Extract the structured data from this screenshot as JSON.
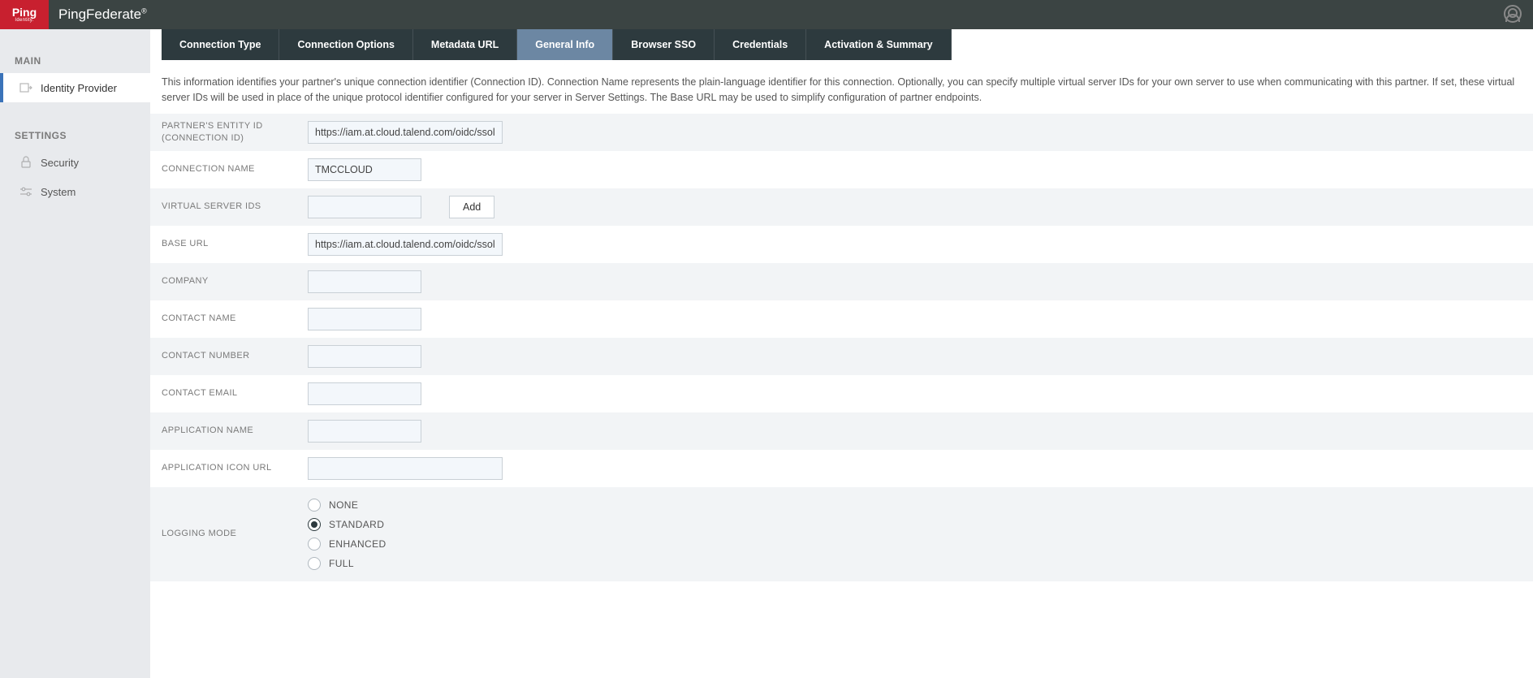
{
  "brand": {
    "logo_main": "Ping",
    "logo_sub": "Identity.",
    "name_a": "Ping",
    "name_b": "Federate"
  },
  "sidebar": {
    "section_main": "MAIN",
    "section_settings": "SETTINGS",
    "items": {
      "idp": "Identity Provider",
      "security": "Security",
      "system": "System"
    }
  },
  "tabs": [
    "Connection Type",
    "Connection Options",
    "Metadata URL",
    "General Info",
    "Browser SSO",
    "Credentials",
    "Activation & Summary"
  ],
  "active_tab_index": 3,
  "description": "This information identifies your partner's unique connection identifier (Connection ID). Connection Name represents the plain-language identifier for this connection. Optionally, you can specify multiple virtual server IDs for your own server to use when communicating with this partner. If set, these virtual server IDs will be used in place of the unique protocol identifier configured for your server in Server Settings. The Base URL may be used to simplify configuration of partner endpoints.",
  "form": {
    "entity_id_label": "PARTNER'S ENTITY ID (CONNECTION ID)",
    "entity_id_value": "https://iam.at.cloud.talend.com/oidc/ssologin",
    "connection_name_label": "CONNECTION NAME",
    "connection_name_value": "TMCCLOUD",
    "virtual_server_ids_label": "VIRTUAL SERVER IDS",
    "virtual_server_ids_value": "",
    "add_button": "Add",
    "base_url_label": "BASE URL",
    "base_url_value": "https://iam.at.cloud.talend.com/oidc/ssologin",
    "company_label": "COMPANY",
    "company_value": "",
    "contact_name_label": "CONTACT NAME",
    "contact_name_value": "",
    "contact_number_label": "CONTACT NUMBER",
    "contact_number_value": "",
    "contact_email_label": "CONTACT EMAIL",
    "contact_email_value": "",
    "application_name_label": "APPLICATION NAME",
    "application_name_value": "",
    "application_icon_url_label": "APPLICATION ICON URL",
    "application_icon_url_value": "",
    "logging_mode_label": "LOGGING MODE",
    "logging_modes": [
      "NONE",
      "STANDARD",
      "ENHANCED",
      "FULL"
    ],
    "logging_mode_selected": "STANDARD"
  }
}
